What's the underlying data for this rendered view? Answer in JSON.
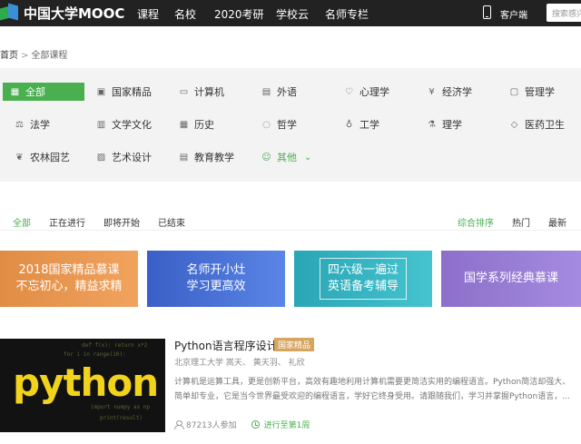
{
  "header": {
    "logo_text": "中国大学MOOC",
    "nav": [
      "课程",
      "名校",
      "2020考研",
      "学校云",
      "名师专栏"
    ],
    "client_label": "客户端",
    "search_placeholder": "搜索感兴趣的课程"
  },
  "breadcrumb": {
    "home": "首页",
    "separator": ">",
    "current": "全部课程"
  },
  "categories": [
    {
      "label": "全部",
      "icon": "grid-icon"
    },
    {
      "label": "国家精品",
      "icon": "medal-icon"
    },
    {
      "label": "计算机",
      "icon": "monitor-icon"
    },
    {
      "label": "外语",
      "icon": "chat-icon"
    },
    {
      "label": "心理学",
      "icon": "heart-icon"
    },
    {
      "label": "经济学",
      "icon": "yuan-icon"
    },
    {
      "label": "管理学",
      "icon": "briefcase-icon"
    },
    {
      "label": "法学",
      "icon": "scale-icon"
    },
    {
      "label": "文学文化",
      "icon": "book-icon"
    },
    {
      "label": "历史",
      "icon": "calendar-icon"
    },
    {
      "label": "哲学",
      "icon": "bulb-icon"
    },
    {
      "label": "工学",
      "icon": "pin-icon"
    },
    {
      "label": "理学",
      "icon": "flask-icon"
    },
    {
      "label": "医药卫生",
      "icon": "pill-icon"
    },
    {
      "label": "农林园艺",
      "icon": "leaf-icon"
    },
    {
      "label": "艺术设计",
      "icon": "palette-icon"
    },
    {
      "label": "教育教学",
      "icon": "doc-icon"
    },
    {
      "label": "其他",
      "icon": "more-icon"
    }
  ],
  "filters": {
    "status": [
      "全部",
      "正在进行",
      "即将开始",
      "已结束"
    ],
    "sort": [
      "综合排序",
      "热门",
      "最新"
    ]
  },
  "banners": [
    {
      "text": "2018国家精品慕课\n不忘初心，精益求精"
    },
    {
      "text": "名师开小灶\n学习更高效"
    },
    {
      "text": "四六级一遍过\n英语备考辅导"
    },
    {
      "text": "国学系列经典慕课"
    }
  ],
  "course": {
    "title": "Python语言程序设计",
    "badge": "国家精品",
    "meta": "北京理工大学    嵩天、 黄天羽、 礼欣",
    "description": "计算机是运算工具，更是创新平台，高效有趣地利用计算机需要更简洁实用的编程语言。Python简洁却强大、简单却专业，它是当今世界最受欢迎的编程语言，学好它终身受用。请跟随我们，学习并掌握Python语言，...",
    "participants": "87213人参加",
    "progress": "进行至第1周",
    "thumbnail_word": "python"
  },
  "colors": {
    "accent": "#49af4f",
    "topbar": "#222222",
    "badge": "#d6a560"
  }
}
